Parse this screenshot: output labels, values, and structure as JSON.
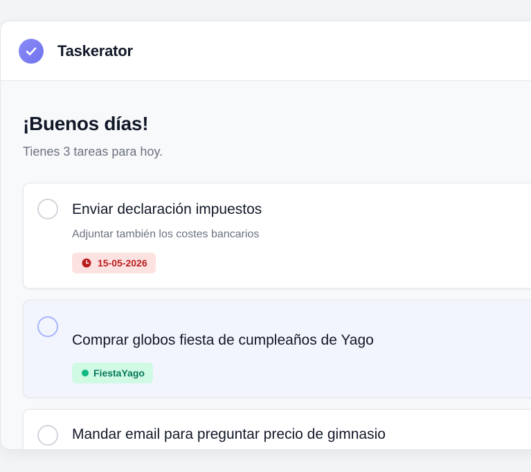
{
  "header": {
    "app_title": "Taskerator",
    "logo_icon": "check-circle-icon"
  },
  "main": {
    "greeting": "¡Buenos días!",
    "subtitle": "Tienes 3 tareas para hoy."
  },
  "tasks": [
    {
      "title": "Enviar declaración impuestos",
      "description": "Adjuntar también los costes bancarios",
      "tag": {
        "type": "date",
        "icon": "clock-icon",
        "text": "15-05-2026",
        "color": "#b91c1c"
      }
    },
    {
      "title": "Comprar globos fiesta de cumpleaños de Yago",
      "tag": {
        "type": "label",
        "icon": "dot-icon",
        "text": "FiestaYago",
        "color": "#10b981"
      }
    },
    {
      "title": "Mandar email para preguntar precio de gimnasio"
    }
  ],
  "colors": {
    "accent": "#7c7ff2",
    "danger": "#b91c1c",
    "success": "#10b981"
  }
}
